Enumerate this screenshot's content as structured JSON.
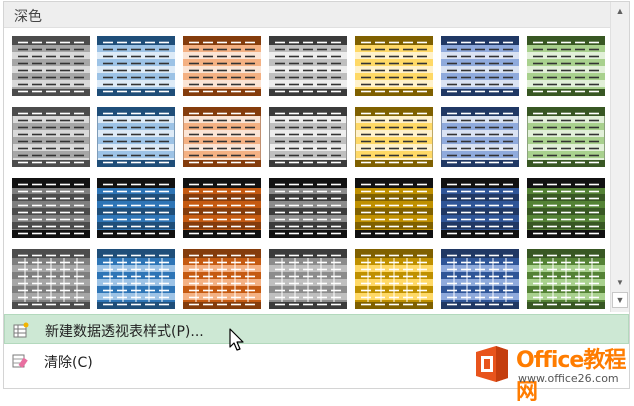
{
  "section_title": "深色",
  "menu": {
    "new_style": "新建数据透视表样式(P)...",
    "clear": "清除(C)"
  },
  "watermark": {
    "brand": "Office教程网",
    "url": "www.office26.com"
  },
  "palettes": [
    {
      "name": "gray",
      "header": "#4c4c4c",
      "band": "#a6a6a6",
      "light": "#d9d9d9",
      "deep": "#7f7f7f"
    },
    {
      "name": "blue",
      "header": "#1f4e79",
      "band": "#9dc3e6",
      "light": "#deebf7",
      "deep": "#2e75b6"
    },
    {
      "name": "orange",
      "header": "#843c0c",
      "band": "#f4b183",
      "light": "#fbe5d6",
      "deep": "#c55a11"
    },
    {
      "name": "silver",
      "header": "#3b3b3b",
      "band": "#bfbfbf",
      "light": "#ededed",
      "deep": "#8c8c8c"
    },
    {
      "name": "gold",
      "header": "#7f6000",
      "band": "#ffd966",
      "light": "#fff2cc",
      "deep": "#bf9000"
    },
    {
      "name": "navy",
      "header": "#203864",
      "band": "#8faadc",
      "light": "#dae3f3",
      "deep": "#2f5597"
    },
    {
      "name": "green",
      "header": "#385723",
      "band": "#a9d18e",
      "light": "#e2f0d9",
      "deep": "#548235"
    }
  ]
}
